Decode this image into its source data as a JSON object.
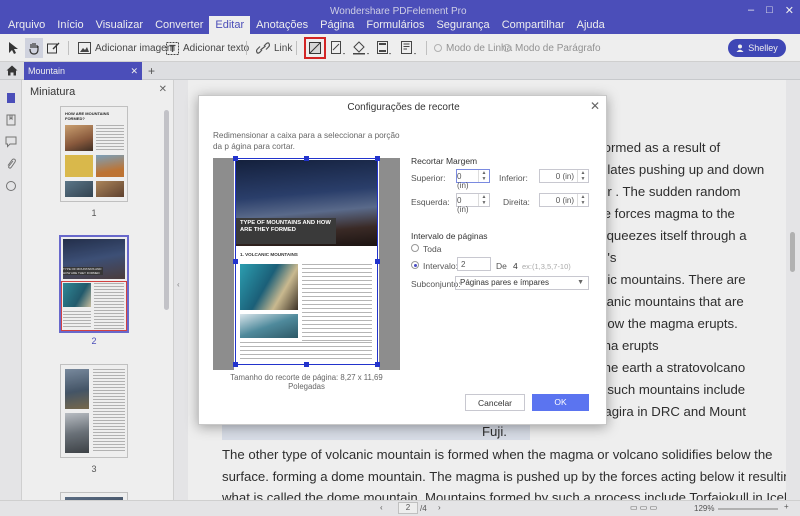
{
  "app": {
    "title": "Wondershare PDFelement Pro",
    "menu": [
      {
        "label": "Arquivo",
        "active": false
      },
      {
        "label": "Início",
        "active": false
      },
      {
        "label": "Visualizar",
        "active": false
      },
      {
        "label": "Converter",
        "active": false
      },
      {
        "label": "Editar",
        "active": true
      },
      {
        "label": "Anotações",
        "active": false
      },
      {
        "label": "Página",
        "active": false
      },
      {
        "label": "Formulários",
        "active": false
      },
      {
        "label": "Segurança",
        "active": false
      },
      {
        "label": "Compartilhar",
        "active": false
      },
      {
        "label": "Ajuda",
        "active": false
      }
    ]
  },
  "toolbar": {
    "add_image": "Adicionar imagem",
    "add_text": "Adicionar texto",
    "link": "Link",
    "line_mode": "Modo de Linha",
    "paragraph_mode": "Modo de Parágrafo",
    "user": "Shelley"
  },
  "tabs": {
    "current": "Mountain"
  },
  "sidebar": {
    "title": "Miniatura",
    "thumbs": [
      {
        "number": "1",
        "heading": "HOW ARE MOUNTAINS FORMED?",
        "selected": false
      },
      {
        "number": "2",
        "heading": "TYPE OF MOUNTAINS AND HOW ARE THEY FORMED",
        "selected": true
      },
      {
        "number": "3",
        "heading": "",
        "selected": false
      }
    ]
  },
  "document": {
    "right_lines": [
      "formed as a result of",
      "plates pushing up and down",
      "er . The sudden random",
      "te forces magma to the",
      "squeezes itself through a",
      "h's",
      "nic mountains. There are",
      "canic mountains that are",
      "how the magma erupts.",
      "ma erupts",
      "the earth a stratovolcano",
      "f such mountains include",
      "ragira in DRC and Mount"
    ],
    "fuji": "Fuji.",
    "body_lines": [
      "The other type of volcanic mountain is formed when the magma or volcano solidifies below the",
      "surface. forming a dome mountain. The magma is pushed up by the forces acting below it resulting in",
      "what is called the dome mountain. Mountains formed by such a process include Torfaiokull in Iceland"
    ]
  },
  "status": {
    "page": "2",
    "total": "/4",
    "zoom": "129%"
  },
  "dialog": {
    "title": "Configurações de recorte",
    "description": "Redimensionar a caixa para a seleccionar a porção da p ágina para cortar.",
    "preview": {
      "page_title": "TYPE OF MOUNTAINS AND HOW ARE THEY FORMED",
      "section": "1. VOLCANIC MOUNTAINS"
    },
    "page_size": "Tamanho do recorte de página: 8,27 x 11,69 Polegadas",
    "crop_margin": {
      "heading": "Recortar Margem",
      "top_label": "Superior:",
      "top_value": "0 (in)",
      "bottom_label": "Inferior:",
      "bottom_value": "0 (in)",
      "left_label": "Esquerda:",
      "left_value": "0 (in)",
      "right_label": "Direita:",
      "right_value": "0 (in)"
    },
    "page_range": {
      "heading": "Intervalo de páginas",
      "all": "Toda",
      "interval": "Intervalo:",
      "from": "2",
      "of": "De",
      "total": "4",
      "example": "ex:(1,3,5,7-10)",
      "subset_label": "Subconjunto:",
      "subset_value": "Páginas pares e ímpares"
    },
    "cancel": "Cancelar",
    "ok": "OK"
  }
}
